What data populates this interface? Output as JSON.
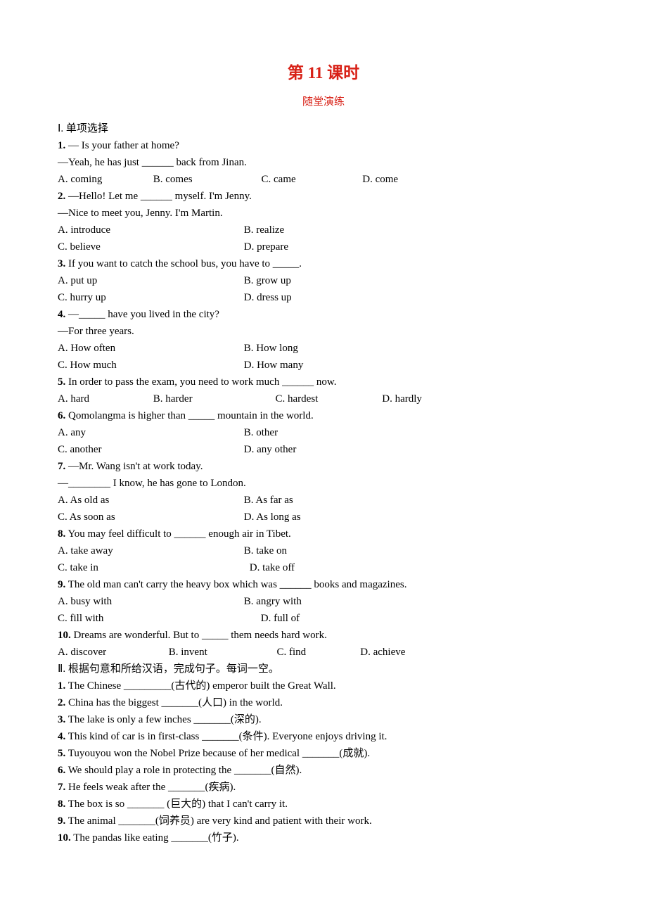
{
  "header": {
    "title": "第 11 课时",
    "subtitle": "随堂演练"
  },
  "section1": {
    "heading": "Ⅰ. 单项选择",
    "q1": {
      "num": "1.",
      "line1": " — Is your father at home?",
      "line2": "—Yeah, he has just ______ back from Jinan.",
      "a": "A. coming",
      "b": "B. comes",
      "c": "C. came",
      "d": "D. come"
    },
    "q2": {
      "num": "2.",
      "line1": " —Hello! Let me ______ myself. I'm Jenny.",
      "line2": "—Nice to meet you, Jenny. I'm Martin.",
      "a": "A. introduce",
      "b": "B. realize",
      "c": "C. believe",
      "d": "D. prepare"
    },
    "q3": {
      "num": "3.",
      "line1": " If you want to catch the school bus, you have to _____.",
      "a": "A. put up",
      "b": "B. grow up",
      "c": "C. hurry up",
      "d": "D. dress up"
    },
    "q4": {
      "num": "4.",
      "line1": " —_____ have you lived in the city?",
      "line2": "—For three years.",
      "a": "A. How often",
      "b": "B. How long",
      "c": "C. How much",
      "d": "D. How many"
    },
    "q5": {
      "num": "5.",
      "line1": " In order to pass the exam, you need to work much ______ now.",
      "a": "A. hard",
      "b": "B. harder",
      "c": "C. hardest",
      "d": "D. hardly"
    },
    "q6": {
      "num": "6.",
      "line1": " Qomolangma is higher than _____ mountain in the world.",
      "a": "A. any",
      "b": "B. other",
      "c": "C. another",
      "d": "D. any other"
    },
    "q7": {
      "num": "7.",
      "line1": " —Mr. Wang isn't at work today.",
      "line2": "—________ I know, he has gone to London.",
      "a": "A. As old as",
      "b": "B. As far as",
      "c": "C. As soon as",
      "d": "D. As long as"
    },
    "q8": {
      "num": "8.",
      "line1": " You may feel difficult to ______ enough air in Tibet.",
      "a": "A. take away",
      "b": "B. take on",
      "c": "C. take in",
      "d": "D. take off"
    },
    "q9": {
      "num": "9.",
      "line1": " The old man can't carry the heavy box which was ______ books and magazines.",
      "a": "A. busy with",
      "b": "B. angry with",
      "c": "C. fill with",
      "d": "D. full of"
    },
    "q10": {
      "num": "10.",
      "line1": " Dreams are wonderful. But to _____ them needs hard work.",
      "a": "A. discover",
      "b": "B. invent",
      "c": "C. find",
      "d": "D. achieve"
    }
  },
  "section2": {
    "heading": "Ⅱ. 根据句意和所给汉语，完成句子。每词一空。",
    "items": {
      "n1": "1.",
      "t1": " The Chinese _________(古代的) emperor built the Great Wall.",
      "n2": "2.",
      "t2": " China has the biggest _______(人口) in the world.",
      "n3": "3.",
      "t3": " The lake is only a few inches _______(深的).",
      "n4": "4.",
      "t4": " This kind of car is in first-class _______(条件). Everyone enjoys driving it.",
      "n5": "5.",
      "t5": " Tuyouyou won the Nobel Prize because of her medical _______(成就).",
      "n6": "6.",
      "t6": " We should play a role in protecting the _______(自然).",
      "n7": "7.",
      "t7": " He feels weak after the _______(疾病).",
      "n8": "8.",
      "t8": " The box is so _______ (巨大的) that I can't carry it.",
      "n9": "9.",
      "t9": " The animal _______(饲养员) are very kind and patient with their work.",
      "n10": "10.",
      "t10": " The pandas like eating _______(竹子)."
    }
  }
}
